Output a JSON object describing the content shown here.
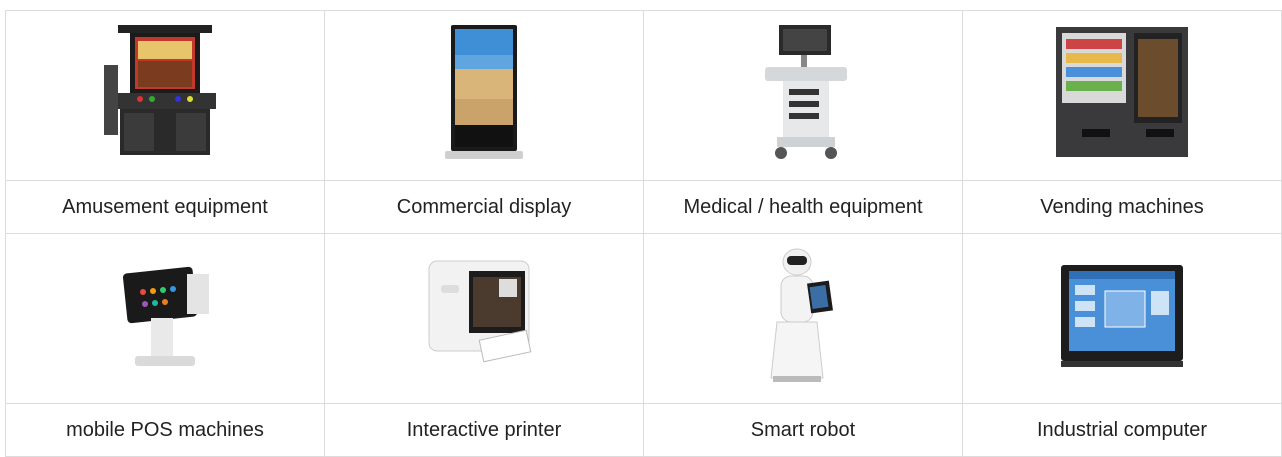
{
  "grid": {
    "row1": [
      {
        "label": "Amusement equipment",
        "icon": "arcade-cabinet-icon"
      },
      {
        "label": "Commercial display",
        "icon": "floor-standing-display-icon"
      },
      {
        "label": "Medical / health equipment",
        "icon": "ultrasound-cart-icon"
      },
      {
        "label": "Vending machines",
        "icon": "vending-machine-icon"
      }
    ],
    "row2": [
      {
        "label": "mobile POS machines",
        "icon": "pos-terminal-icon"
      },
      {
        "label": "Interactive printer",
        "icon": "photo-printer-icon"
      },
      {
        "label": "Smart robot",
        "icon": "service-robot-icon"
      },
      {
        "label": "Industrial computer",
        "icon": "industrial-panel-pc-icon"
      }
    ]
  },
  "colors": {
    "border": "#dcdcdc",
    "text": "#222222"
  }
}
